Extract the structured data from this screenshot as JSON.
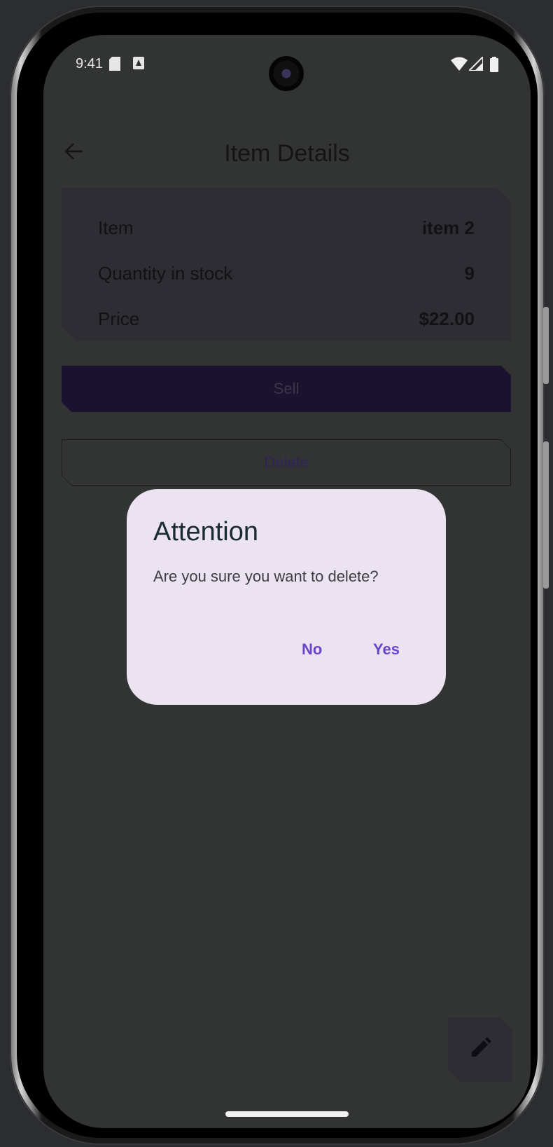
{
  "status_bar": {
    "time": "9:41",
    "icons": [
      "sd-card-icon",
      "notification-icon",
      "wifi-icon",
      "signal-icon",
      "battery-icon"
    ]
  },
  "top_bar": {
    "title": "Item Details",
    "back_icon": "arrow-back-icon"
  },
  "details": {
    "rows": [
      {
        "label": "Item",
        "value": "item 2"
      },
      {
        "label": "Quantity in stock",
        "value": "9"
      },
      {
        "label": "Price",
        "value": "$22.00"
      }
    ]
  },
  "actions": {
    "sell_label": "Sell",
    "delete_label": "Delete"
  },
  "dialog": {
    "title": "Attention",
    "message": "Are you sure you want to delete?",
    "no_label": "No",
    "yes_label": "Yes"
  },
  "fab": {
    "icon": "edit-pencil-icon"
  },
  "colors": {
    "screen_bg": "#323434",
    "dialog_bg": "#ebe4f0",
    "accent": "#6a45c9",
    "sell_button": "#1b1230"
  }
}
